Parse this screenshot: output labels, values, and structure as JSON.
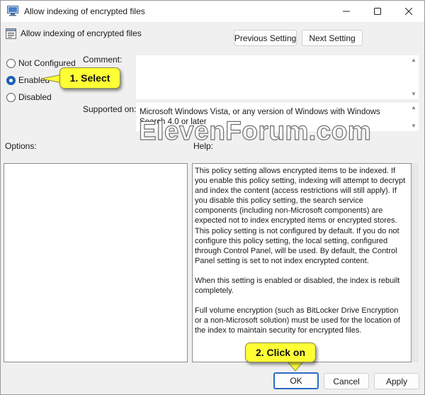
{
  "window": {
    "title": "Allow indexing of encrypted files"
  },
  "header": {
    "policy_name": "Allow indexing of encrypted files",
    "previous_setting_label": "Previous Setting",
    "next_setting_label": "Next Setting"
  },
  "state": {
    "options": [
      {
        "label": "Not Configured",
        "checked": false
      },
      {
        "label": "Enabled",
        "checked": true
      },
      {
        "label": "Disabled",
        "checked": false
      }
    ]
  },
  "comment": {
    "label": "Comment:",
    "value": ""
  },
  "supported_on": {
    "label": "Supported on:",
    "value": "Microsoft Windows Vista, or any version of Windows with Windows Search 4.0 or later"
  },
  "options_section": {
    "label": "Options:"
  },
  "help_section": {
    "label": "Help:",
    "paragraphs": [
      "This policy setting allows encrypted items to be indexed. If you enable this policy setting, indexing  will attempt to decrypt and index the content (access restrictions will still apply). If you disable this policy setting, the search service components (including non-Microsoft components) are expected not to index encrypted items or encrypted stores. This policy setting is not configured by default. If you do not configure this policy setting, the local setting, configured through Control Panel, will be used. By default, the Control Panel setting is set to not index encrypted content.",
      "When this setting is enabled or disabled, the index is rebuilt completely.",
      "Full volume encryption (such as BitLocker Drive Encryption or a non-Microsoft solution) must be used for the location of the index to maintain security for encrypted files."
    ]
  },
  "footer": {
    "ok_label": "OK",
    "cancel_label": "Cancel",
    "apply_label": "Apply"
  },
  "annotations": {
    "callout_1": "1. Select",
    "callout_2": "2. Click on",
    "callout_color": "#ffff36"
  },
  "watermark": "ElevenForum.com",
  "colors": {
    "accent": "#1f5fb5",
    "window_bg": "#f0f0f0"
  }
}
